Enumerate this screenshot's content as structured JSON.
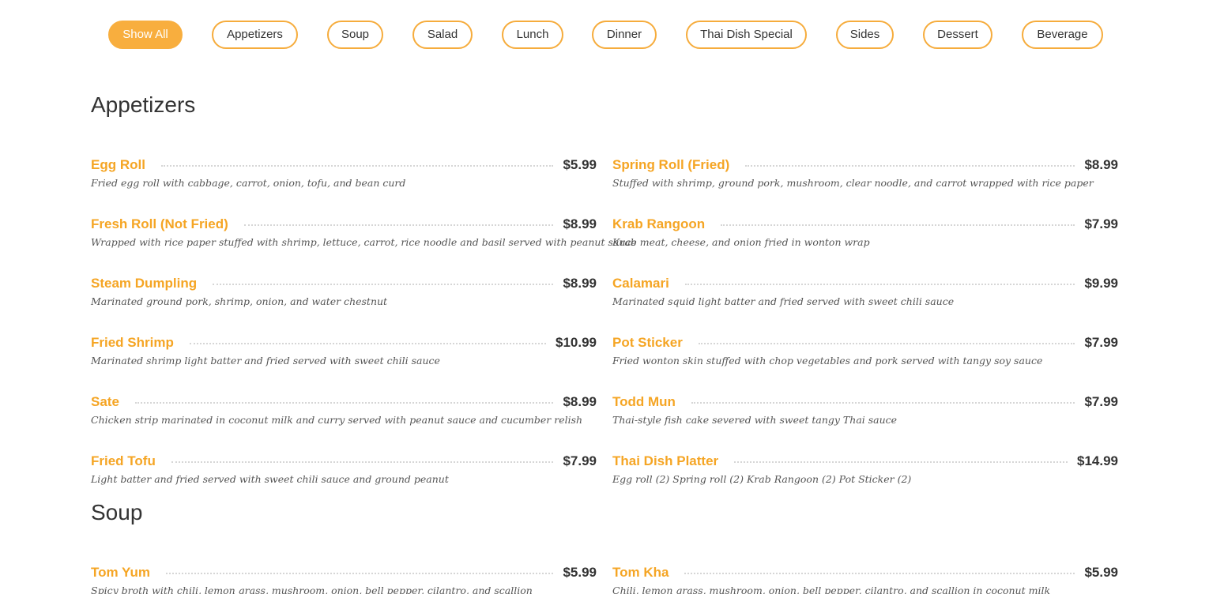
{
  "filters": [
    {
      "label": "Show All",
      "active": true
    },
    {
      "label": "Appetizers",
      "active": false
    },
    {
      "label": "Soup",
      "active": false
    },
    {
      "label": "Salad",
      "active": false
    },
    {
      "label": "Lunch",
      "active": false
    },
    {
      "label": "Dinner",
      "active": false
    },
    {
      "label": "Thai Dish Special",
      "active": false
    },
    {
      "label": "Sides",
      "active": false
    },
    {
      "label": "Dessert",
      "active": false
    },
    {
      "label": "Beverage",
      "active": false
    }
  ],
  "colors": {
    "accent": "#f8ae3e",
    "item_name": "#f5a524",
    "text_dark": "#333333"
  },
  "sections": [
    {
      "title": "Appetizers",
      "items": [
        {
          "name": "Egg Roll",
          "price": "$5.99",
          "desc": "Fried egg roll with cabbage, carrot, onion, tofu, and bean curd"
        },
        {
          "name": "Spring Roll (Fried)",
          "price": "$8.99",
          "desc": "Stuffed with shrimp, ground pork, mushroom, clear noodle, and carrot wrapped with rice paper"
        },
        {
          "name": "Fresh Roll (Not Fried)",
          "price": "$8.99",
          "desc": "Wrapped with rice paper stuffed with shrimp, lettuce, carrot, rice noodle and basil served with peanut sauce"
        },
        {
          "name": "Krab Rangoon",
          "price": "$7.99",
          "desc": "Krab meat, cheese, and onion fried in wonton wrap"
        },
        {
          "name": "Steam Dumpling",
          "price": "$8.99",
          "desc": "Marinated ground pork, shrimp, onion, and water chestnut"
        },
        {
          "name": "Calamari",
          "price": "$9.99",
          "desc": "Marinated squid light batter and fried served with sweet chili sauce"
        },
        {
          "name": "Fried Shrimp",
          "price": "$10.99",
          "desc": "Marinated shrimp light batter and fried served with sweet chili sauce"
        },
        {
          "name": "Pot Sticker",
          "price": "$7.99",
          "desc": "Fried wonton skin stuffed with chop vegetables and pork served with tangy soy sauce"
        },
        {
          "name": "Sate",
          "price": "$8.99",
          "desc": "Chicken strip marinated in coconut milk and curry served with peanut sauce and cucumber relish"
        },
        {
          "name": "Todd Mun",
          "price": "$7.99",
          "desc": "Thai-style fish cake severed with sweet tangy Thai sauce"
        },
        {
          "name": "Fried Tofu",
          "price": "$7.99",
          "desc": "Light batter and fried served with sweet chili sauce and ground peanut"
        },
        {
          "name": "Thai Dish Platter",
          "price": "$14.99",
          "desc": "Egg roll (2) Spring roll (2) Krab Rangoon (2) Pot Sticker (2)"
        }
      ]
    },
    {
      "title": "Soup",
      "items": [
        {
          "name": "Tom Yum",
          "price": "$5.99",
          "desc": "Spicy broth with chili, lemon grass, mushroom, onion, bell pepper, cilantro, and scallion"
        },
        {
          "name": "Tom Kha",
          "price": "$5.99",
          "desc": "Chili, lemon grass, mushroom, onion, bell pepper, cilantro, and scallion in coconut milk"
        }
      ]
    }
  ]
}
